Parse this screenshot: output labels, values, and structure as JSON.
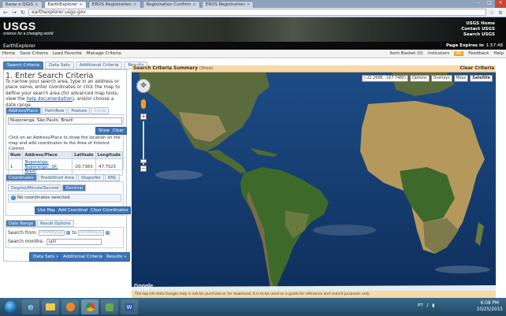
{
  "browser": {
    "tabs": [
      {
        "label": "Базы о QGIS",
        "active": false
      },
      {
        "label": "EarthExplorer",
        "active": true
      },
      {
        "label": "EROS Registration",
        "active": false
      },
      {
        "label": "Registration Confirm",
        "active": false
      },
      {
        "label": "EROS Registration",
        "active": false
      }
    ],
    "url": "earthexplorer.usgs.gov"
  },
  "banner": {
    "logo": "USGS",
    "tagline": "science for a changing world",
    "links": [
      "USGS Home",
      "Contact USGS",
      "Search USGS"
    ]
  },
  "appbar": {
    "title": "EarthExplorer",
    "expires_label": "Page Expires in",
    "timer": "1:57:48"
  },
  "menu": {
    "items": [
      "Home",
      "Save Criteria",
      "Load Favorite",
      "Manage Criteria"
    ],
    "right": [
      "Item Basket (0)",
      "Indicators",
      "Feedback",
      "Help"
    ],
    "badge": "JBK"
  },
  "lefttabs": [
    {
      "label": "Search Criteria",
      "active": true
    },
    {
      "label": "Data Sets",
      "active": false
    },
    {
      "label": "Additional Criteria",
      "active": false
    },
    {
      "label": "Results",
      "active": false
    }
  ],
  "step": {
    "title": "1. Enter Search Criteria",
    "text": "To narrow your search area, type in an address or place name, enter coordinates or click the map to define your search area (for advanced map tools, view the",
    "link": "help documentation",
    "text_after": "), and/or choose a date range."
  },
  "address_tabs": [
    {
      "label": "Address/Place",
      "state": "active"
    },
    {
      "label": "Path/Row",
      "state": "normal"
    },
    {
      "label": "Feature",
      "state": "normal"
    },
    {
      "label": "Circle",
      "state": "disabled"
    }
  ],
  "address": {
    "value": "Nuporanga, São Paulo, Brazil",
    "show": "Show",
    "clear": "Clear",
    "instructions": "Click on an Address/Place to show the location on the map and add coordinates to the Area of Interest Control."
  },
  "results_table": {
    "headers": [
      "Num",
      "Address/Place",
      "Latitude",
      "Longitude"
    ],
    "rows": [
      [
        "1",
        "Nuporanga, Nuporanga - SP, Brazil",
        "-20.7363",
        "-47.7523"
      ]
    ]
  },
  "coord_tabs": [
    {
      "label": "Coordinates",
      "state": "active"
    },
    {
      "label": "Predefined Area",
      "state": "normal"
    },
    {
      "label": "Shapefile",
      "state": "normal"
    },
    {
      "label": "KML",
      "state": "normal"
    }
  ],
  "format_tabs": [
    {
      "label": "Degree/Minute/Second",
      "state": "normal"
    },
    {
      "label": "Decimal",
      "state": "active"
    }
  ],
  "coords": {
    "none": "No coordinates selected.",
    "use_map": "Use Map",
    "add": "Add Coordinate",
    "clear": "Clear Coordinates"
  },
  "date_tabs": [
    {
      "label": "Date Range",
      "state": "active"
    },
    {
      "label": "Result Options",
      "state": "normal"
    }
  ],
  "date": {
    "from_label": "Search from:",
    "to_label": "to",
    "placeholder": "mm/dd/yyyy",
    "months_label": "Search months:",
    "months_value": "(all)"
  },
  "nav_buttons": [
    "Data Sets »",
    "Additional Criteria »",
    "Results »"
  ],
  "map": {
    "summary_title": "Search Criteria Summary",
    "show_label": "(Show)",
    "clear_label": "Clear Criteria",
    "coord_readout": "(-22.2688, -167.7480)",
    "controls": [
      "Options",
      "Overlays",
      "Maps",
      "Satellite"
    ],
    "footer": "The tap-tile-data Google map is not for purchase or for download; it is to be used as a guide for reference and search purposes only.",
    "google": "Google"
  },
  "taskbar": {
    "time": "6:08 PM",
    "date": "10/25/2015",
    "lang": "PT"
  }
}
